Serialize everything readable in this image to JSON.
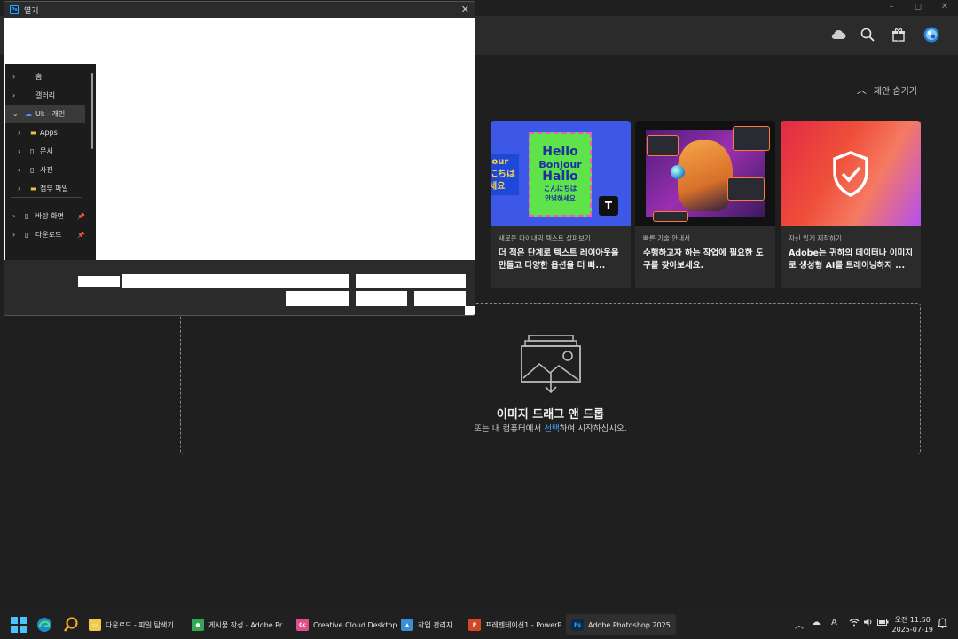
{
  "photoshop": {
    "window_controls": [
      "–",
      "◻",
      "✕"
    ],
    "header_icons": [
      "cloud-icon",
      "search-icon",
      "gift-icon",
      "avatar"
    ],
    "hide_suggestions": "제안 숨기기",
    "cards": [
      {
        "kicker": "새로운 다이내믹 텍스트 살펴보기",
        "title": "더 적은 단계로 텍스트 레이아웃을 만들고 다양한 옵션을 더 빠...",
        "thumb": {
          "lines": [
            "Hello",
            "Bonjour",
            "Hallo",
            "こんにちは",
            "안녕하세요"
          ],
          "side": "jour にちは 세요"
        }
      },
      {
        "kicker": "빠른 기술 안내서",
        "title": "수행하고자 하는 작업에 필요한 도구를 찾아보세요."
      },
      {
        "kicker": "자신 있게 제작하기",
        "title": "Adobe는 귀하의 데이터나 이미지로 생성형 AI를 트레이닝하지 ..."
      }
    ],
    "dropzone": {
      "title": "이미지 드래그 앤 드롭",
      "sub_before": "또는 내 컴퓨터에서 ",
      "sub_link": "선택",
      "sub_after": "하여 시작하십시오."
    }
  },
  "open_dialog": {
    "title": "열기",
    "app_badge": "Ps",
    "close": "✕",
    "nav": [
      {
        "label": "홈",
        "icon": "home-icon",
        "indent": 0,
        "pin": false,
        "selected": false
      },
      {
        "label": "갤러리",
        "icon": "gallery-icon",
        "indent": 0,
        "pin": false,
        "selected": false
      },
      {
        "label": "Uk - 개인",
        "icon": "onedrive-icon",
        "indent": 0,
        "pin": false,
        "selected": true,
        "expanded": true
      },
      {
        "label": "Apps",
        "icon": "folder-icon",
        "indent": 1,
        "pin": false,
        "selected": false
      },
      {
        "label": "문서",
        "icon": "document-icon",
        "indent": 1,
        "pin": false,
        "selected": false
      },
      {
        "label": "사진",
        "icon": "document-icon",
        "indent": 1,
        "pin": false,
        "selected": false
      },
      {
        "label": "첨부 파일",
        "icon": "folder-icon",
        "indent": 1,
        "pin": false,
        "selected": false
      },
      {
        "label": "바탕 화면",
        "icon": "document-icon",
        "indent": 0,
        "pin": true,
        "selected": false
      },
      {
        "label": "다운로드",
        "icon": "document-icon",
        "indent": 0,
        "pin": true,
        "selected": false
      }
    ]
  },
  "taskbar": {
    "apps": [
      {
        "label": "다운로드 - 파일 탐색기",
        "icon": "file-explorer-icon",
        "color": "#f2c94c"
      },
      {
        "label": "게시물 작성 - Adobe Pr",
        "icon": "chrome-icon",
        "color": "#34a853"
      },
      {
        "label": "Creative Cloud Desktop",
        "icon": "creative-cloud-icon",
        "color": "#e14c8a"
      },
      {
        "label": "작업 관리자",
        "icon": "task-manager-icon",
        "color": "#3b8fd6"
      },
      {
        "label": "프레젠테이션1 - PowerP",
        "icon": "powerpoint-icon",
        "color": "#d24726"
      },
      {
        "label": "Adobe Photoshop 2025",
        "icon": "photoshop-icon",
        "color": "#31a8ff",
        "active": true
      }
    ],
    "ime": "A",
    "time": "오전 11:50",
    "date": "2025-07-19"
  }
}
